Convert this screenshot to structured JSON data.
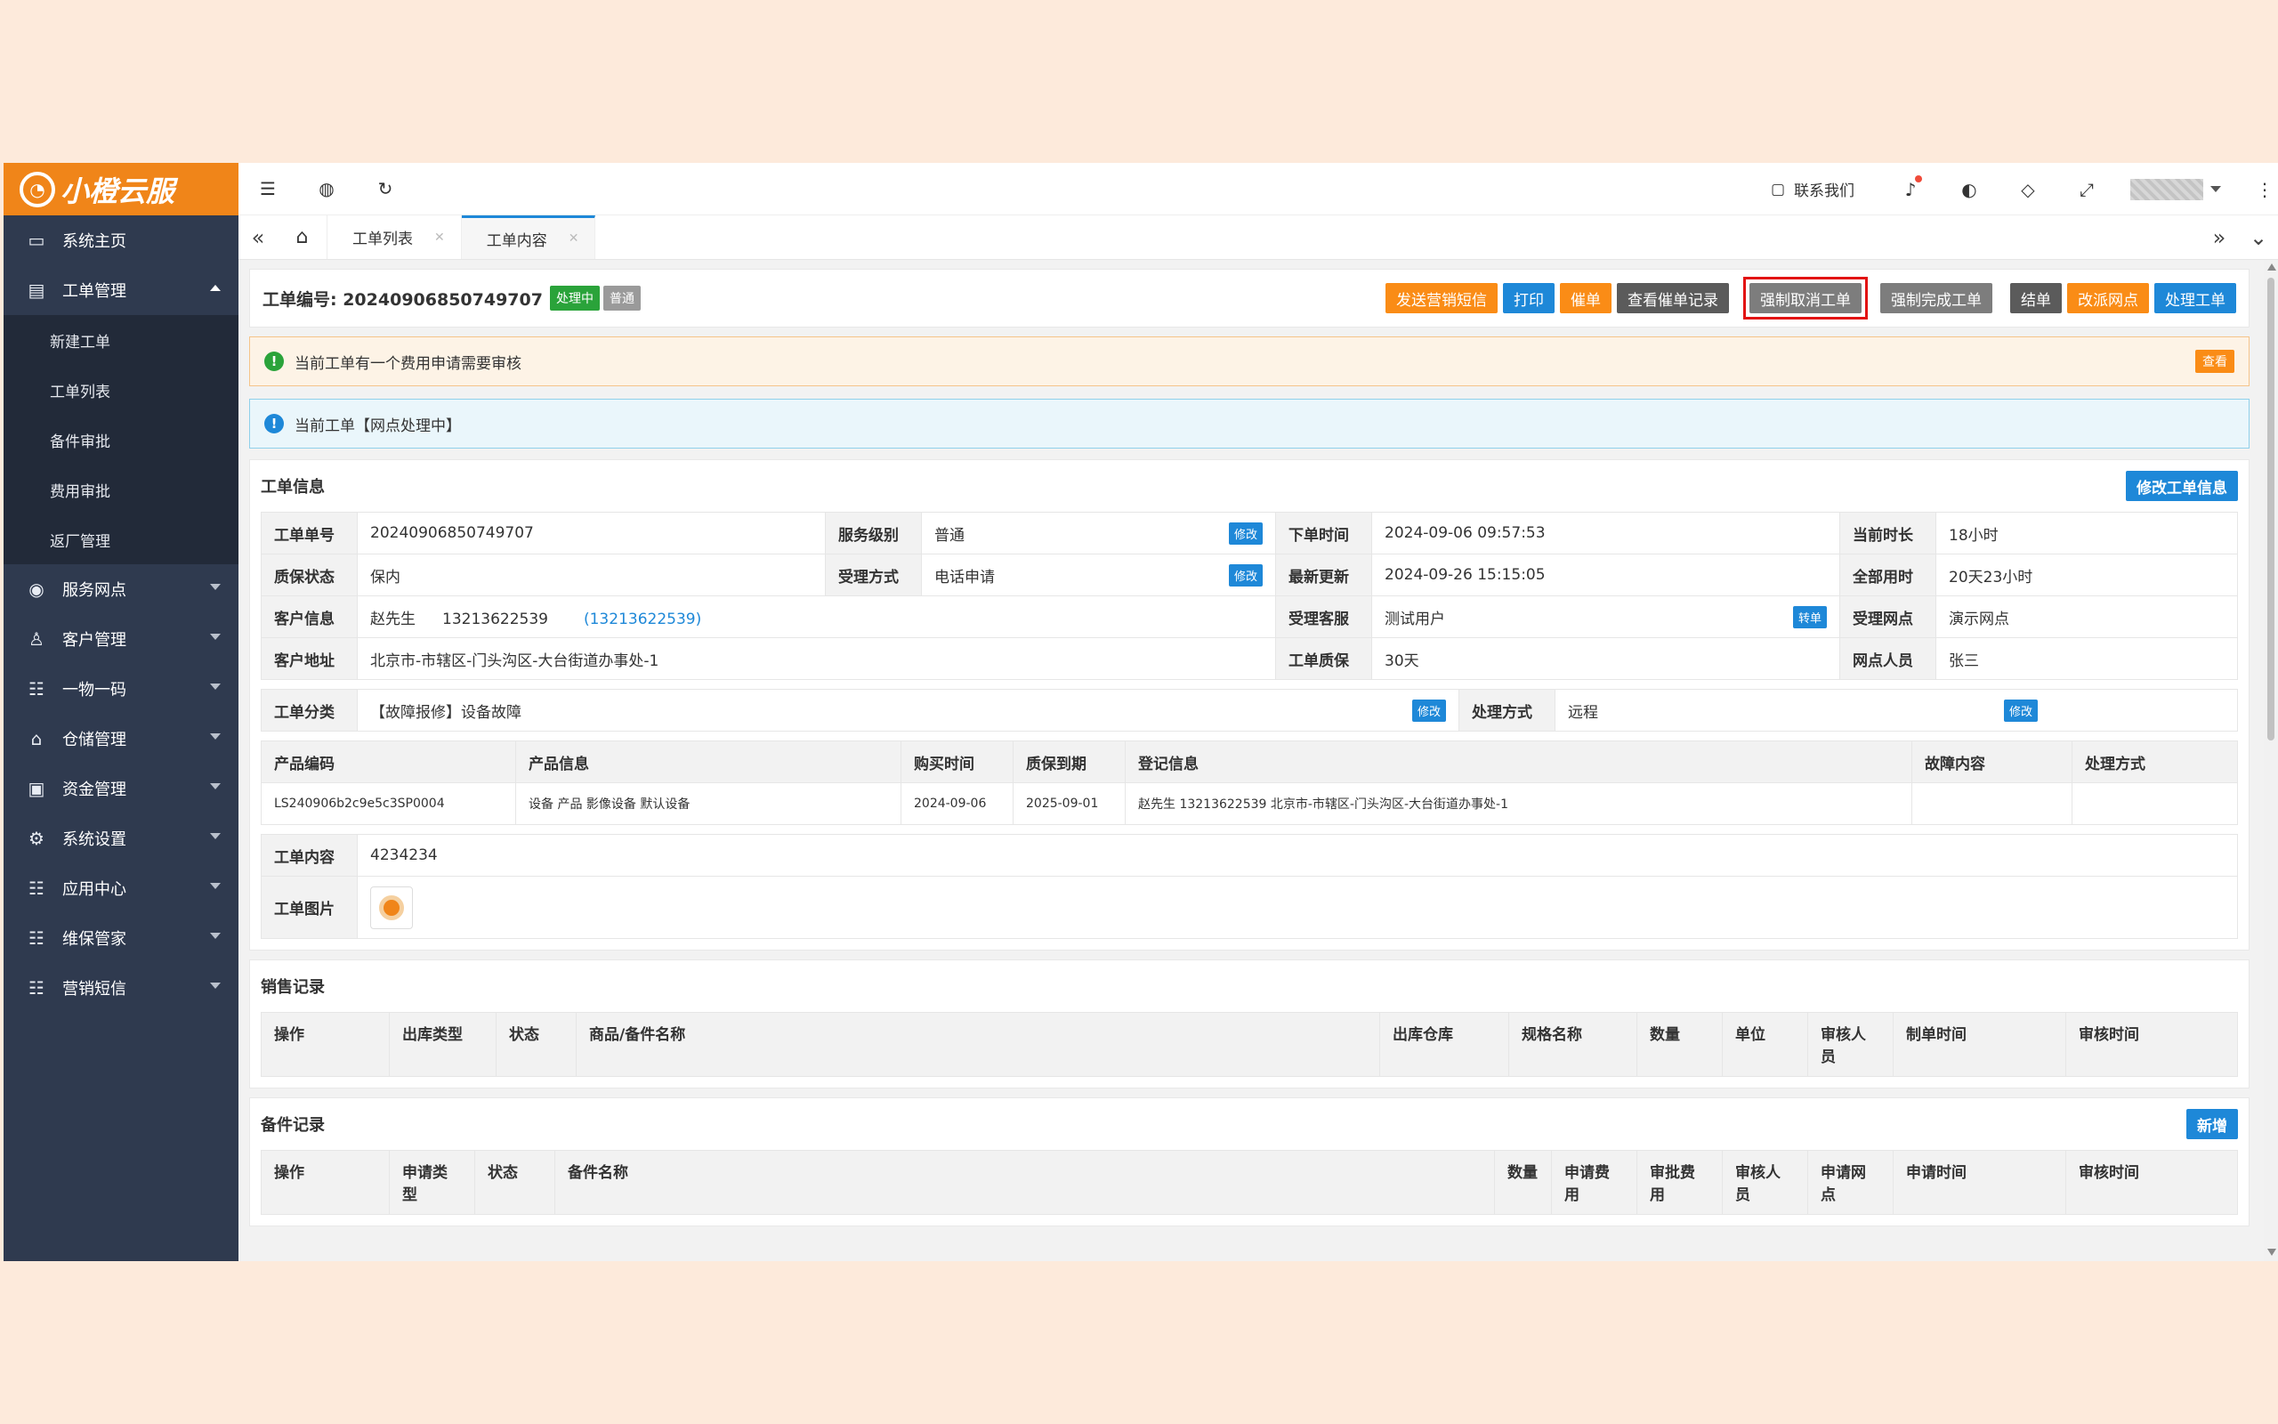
{
  "brand": {
    "logo_text": "小橙云服"
  },
  "sidebar": {
    "items": [
      {
        "label": "系统主页",
        "icon": "monitor-icon"
      },
      {
        "label": "工单管理",
        "icon": "document-icon",
        "expanded": true,
        "children": [
          "新建工单",
          "工单列表",
          "备件审批",
          "费用审批",
          "返厂管理"
        ]
      },
      {
        "label": "服务网点",
        "icon": "globe-icon"
      },
      {
        "label": "客户管理",
        "icon": "user-icon"
      },
      {
        "label": "一物一码",
        "icon": "grid-icon"
      },
      {
        "label": "仓储管理",
        "icon": "bank-icon"
      },
      {
        "label": "资金管理",
        "icon": "money-icon"
      },
      {
        "label": "系统设置",
        "icon": "gear-icon"
      },
      {
        "label": "应用中心",
        "icon": "grid-icon"
      },
      {
        "label": "维保管家",
        "icon": "grid-icon"
      },
      {
        "label": "营销短信",
        "icon": "grid-icon"
      }
    ]
  },
  "header": {
    "contact_label": "联系我们"
  },
  "tabs": [
    {
      "label": "工单列表"
    },
    {
      "label": "工单内容",
      "active": true
    }
  ],
  "order": {
    "number_label": "工单编号: 20240906850749707",
    "status_badge": "处理中",
    "level_badge": "普通",
    "actions": {
      "sms": "发送营销短信",
      "print": "打印",
      "urge": "催单",
      "urge_log": "查看催单记录",
      "force_cancel": "强制取消工单",
      "force_complete": "强制完成工单",
      "settle": "结单",
      "reassign": "改派网点",
      "process": "处理工单"
    }
  },
  "alerts": {
    "fee": "当前工单有一个费用申请需要审核",
    "fee_view": "查看",
    "status": "当前工单【网点处理中】"
  },
  "info": {
    "title": "工单信息",
    "edit_button": "修改工单信息",
    "edit_mini": "修改",
    "transfer_mini": "转单",
    "labels": {
      "no": "工单单号",
      "level": "服务级别",
      "order_time": "下单时间",
      "duration": "当前时长",
      "warranty": "质保状态",
      "accept": "受理方式",
      "update": "最新更新",
      "total": "全部用时",
      "customer": "客户信息",
      "agent": "受理客服",
      "site": "受理网点",
      "address": "客户地址",
      "period": "工单质保",
      "staff": "网点人员",
      "category": "工单分类",
      "handle": "处理方式",
      "content": "工单内容",
      "image": "工单图片"
    },
    "values": {
      "no": "20240906850749707",
      "level": "普通",
      "order_time": "2024-09-06 09:57:53",
      "duration": "18小时",
      "warranty": "保内",
      "accept": "电话申请",
      "update": "2024-09-26 15:15:05",
      "total": "20天23小时",
      "customer_name": "赵先生",
      "customer_phone": "13213622539",
      "customer_phone_link": "(13213622539)",
      "agent": "测试用户",
      "site": "演示网点",
      "address": "北京市-市辖区-门头沟区-大台街道办事处-1",
      "period": "30天",
      "staff": "张三",
      "category": "【故障报修】设备故障",
      "handle": "远程",
      "content": "4234234"
    }
  },
  "product": {
    "headers": [
      "产品编码",
      "产品信息",
      "购买时间",
      "质保到期",
      "登记信息",
      "故障内容",
      "处理方式"
    ],
    "row": [
      "LS240906b2c9e5c3SP0004",
      "设备 产品 影像设备 默认设备",
      "2024-09-06",
      "2025-09-01",
      "赵先生 13213622539 北京市-市辖区-门头沟区-大台街道办事处-1",
      "",
      ""
    ]
  },
  "sales": {
    "title": "销售记录",
    "headers": [
      "操作",
      "出库类型",
      "状态",
      "商品/备件名称",
      "出库仓库",
      "规格名称",
      "数量",
      "单位",
      "审核人员",
      "制单时间",
      "审核时间"
    ]
  },
  "parts": {
    "title": "备件记录",
    "add_button": "新增",
    "headers": [
      "操作",
      "申请类型",
      "状态",
      "备件名称",
      "数量",
      "申请费用",
      "审批费用",
      "审核人员",
      "申请网点",
      "申请时间",
      "审核时间"
    ]
  }
}
